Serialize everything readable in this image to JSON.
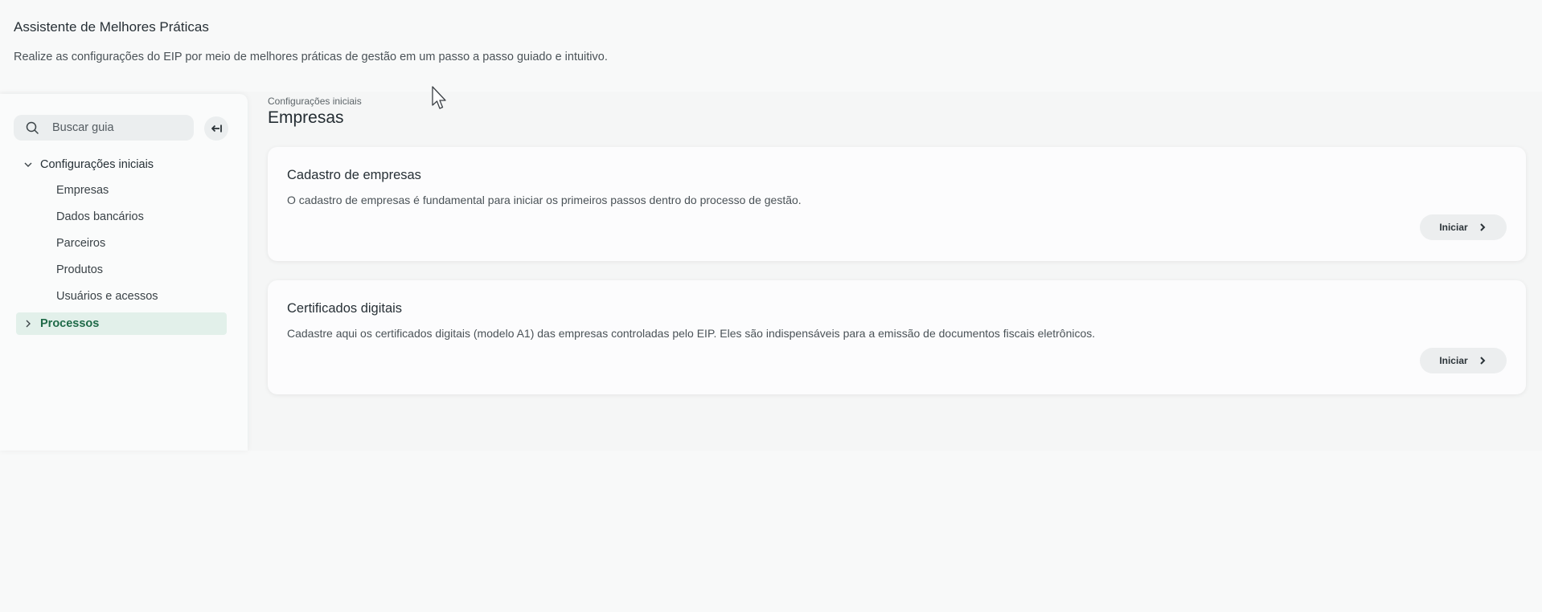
{
  "header": {
    "title": "Assistente de Melhores Práticas",
    "subtitle": "Realize as configurações do EIP por meio de melhores práticas de gestão em um passo a passo guiado e intuitivo."
  },
  "sidebar": {
    "search": {
      "placeholder": "Buscar guia",
      "value": ""
    },
    "collapse_icon": "collapse-left-icon",
    "groups": [
      {
        "label": "Configurações iniciais",
        "expanded": true,
        "items": [
          {
            "label": "Empresas"
          },
          {
            "label": "Dados bancários"
          },
          {
            "label": "Parceiros"
          },
          {
            "label": "Produtos"
          },
          {
            "label": "Usuários e acessos"
          }
        ]
      },
      {
        "label": "Processos",
        "expanded": false,
        "selected": true
      }
    ]
  },
  "main": {
    "breadcrumb": "Configurações iniciais",
    "title": "Empresas",
    "cards": [
      {
        "title": "Cadastro de empresas",
        "description": "O cadastro de empresas é fundamental para iniciar os primeiros passos dentro do processo de gestão.",
        "button_label": "Iniciar"
      },
      {
        "title": "Certificados digitais",
        "description": "Cadastre aqui os certificados digitais (modelo A1) das empresas controladas pelo EIP. Eles são indispensáveis para a emissão de documentos fiscais eletrônicos.",
        "button_label": "Iniciar"
      }
    ]
  },
  "colors": {
    "accent": "#1f6a48",
    "selected_bg": "#e2f0ea",
    "button_bg": "#eceeef"
  }
}
